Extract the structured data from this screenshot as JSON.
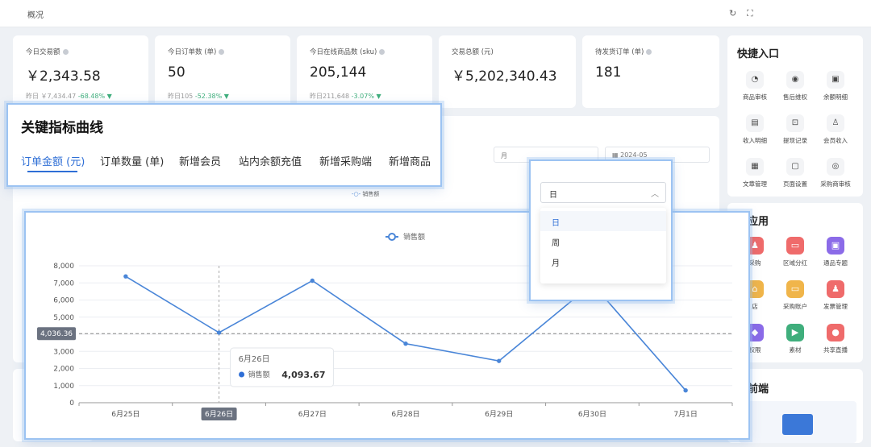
{
  "topbar": {
    "crumb": "概况",
    "refresh_icon": "refresh-icon",
    "fullscreen_icon": "fullscreen-icon"
  },
  "stats": [
    {
      "label": "今日交易额",
      "value": "￥2,343.58",
      "sub_text": "昨日 ￥7,434.47",
      "sub_pct": "-68.48% ▼"
    },
    {
      "label": "今日订单数 (单)",
      "value": "50",
      "sub_text": "昨日105",
      "sub_pct": "-52.38% ▼"
    },
    {
      "label": "今日在线商品数 (sku)",
      "value": "205,144",
      "sub_text": "昨日211,648",
      "sub_pct": "-3.07% ▼"
    },
    {
      "label": "交易总额 (元)",
      "value": "￥5,202,340.43",
      "sub_text": "",
      "sub_pct": ""
    },
    {
      "label": "待发货订单 (单)",
      "value": "181",
      "sub_text": "",
      "sub_pct": ""
    }
  ],
  "quick": {
    "title": "快捷入口",
    "items": [
      "商品审核",
      "售后维权",
      "余额明细",
      "收入明细",
      "提现记录",
      "会员收入",
      "文章管理",
      "页面设置",
      "采购商审核"
    ]
  },
  "apps": {
    "title": "用应用",
    "items": [
      "采购",
      "区域分红",
      "通品专题",
      "店",
      "采购账户",
      "发票管理",
      "权限",
      "素材",
      "共享直播"
    ]
  },
  "frontend": {
    "title": "问前端"
  },
  "bg_controls": {
    "period_select": "月",
    "date_picker": "2024-05",
    "legend": "销售额"
  },
  "tabs_zoom": {
    "title": "关键指标曲线",
    "tabs": [
      "订单金额 (元)",
      "订单数量 (单)",
      "新增会员",
      "站内余额充值",
      "新增采购端",
      "新增商品"
    ],
    "active_index": 0
  },
  "dropdown_zoom": {
    "value": "日",
    "options": [
      "日",
      "周",
      "月"
    ],
    "selected_index": 0
  },
  "chart_data": {
    "type": "line",
    "categories": [
      "6月25日",
      "6月26日",
      "6月27日",
      "6月28日",
      "6月29日",
      "6月30日",
      "7月1日"
    ],
    "series": [
      {
        "name": "销售额",
        "values": [
          7380,
          4094,
          7130,
          3450,
          2440,
          6950,
          720
        ]
      }
    ],
    "ylim": [
      0,
      8000
    ],
    "yticks": [
      "8,000",
      "7,000",
      "6,000",
      "5,000",
      "4,000",
      "3,000",
      "2,000",
      "1,000",
      "0"
    ],
    "crosshair_label": "4,036.36",
    "crosshair_value": 4036.36,
    "hover_index": 1,
    "tooltip": {
      "date": "6月26日",
      "series": "销售额",
      "value": "4,093.67"
    },
    "color": "#4a86d8",
    "legend_position": "top-center",
    "grid": true
  }
}
